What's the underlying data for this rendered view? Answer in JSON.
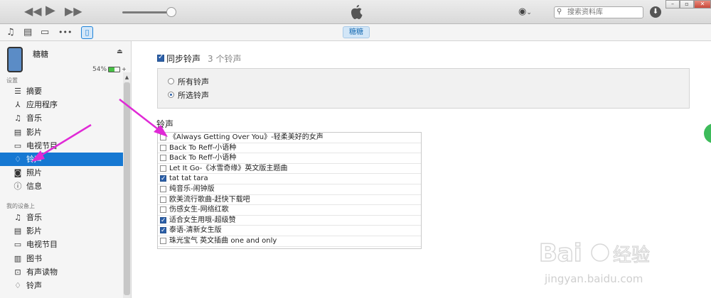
{
  "search": {
    "placeholder": "搜索资料库"
  },
  "device": {
    "name": "糖糖",
    "battery": "54%",
    "battery_level": 0.54
  },
  "device_tab": "糖糖",
  "sidebar": {
    "settings_heading": "设置",
    "settings_items": [
      {
        "label": "摘要",
        "icon": "summary-icon"
      },
      {
        "label": "应用程序",
        "icon": "apps-icon"
      },
      {
        "label": "音乐",
        "icon": "music-icon"
      },
      {
        "label": "影片",
        "icon": "film-icon"
      },
      {
        "label": "电视节目",
        "icon": "tv-icon"
      },
      {
        "label": "铃声",
        "icon": "bell-icon"
      },
      {
        "label": "照片",
        "icon": "camera-icon"
      },
      {
        "label": "信息",
        "icon": "info-icon"
      }
    ],
    "ondevice_heading": "我的设备上",
    "ondevice_items": [
      {
        "label": "音乐",
        "icon": "music-icon"
      },
      {
        "label": "影片",
        "icon": "film-icon"
      },
      {
        "label": "电视节目",
        "icon": "tv-icon"
      },
      {
        "label": "图书",
        "icon": "book-icon"
      },
      {
        "label": "有声读物",
        "icon": "audiobook-icon"
      },
      {
        "label": "铃声",
        "icon": "bell-icon"
      }
    ]
  },
  "main": {
    "sync_label": "同步铃声",
    "sync_count": "3 个铃声",
    "sync_checked": true,
    "options": [
      {
        "label": "所有铃声",
        "selected": false
      },
      {
        "label": "所选铃声",
        "selected": true
      }
    ],
    "ringtones_heading": "铃声",
    "ringtones": [
      {
        "name": "《Always Getting Over You》-轻柔美好的女声",
        "checked": false
      },
      {
        "name": "Back To Reff-小语种",
        "checked": false
      },
      {
        "name": "Back To Reff-小语种",
        "checked": false
      },
      {
        "name": "Let It Go-《冰雪奇缘》英文版主题曲",
        "checked": false
      },
      {
        "name": "tat tat tara",
        "checked": true
      },
      {
        "name": "纯音乐-闹钟版",
        "checked": false
      },
      {
        "name": "欧美流行歌曲-赶快下载吧",
        "checked": false
      },
      {
        "name": "伤感女生-网络红歌",
        "checked": false
      },
      {
        "name": "适合女生用哦-超级赞",
        "checked": true
      },
      {
        "name": "泰语-清新女生版",
        "checked": true
      },
      {
        "name": "珠光宝气 英文插曲 one and only",
        "checked": false
      }
    ]
  },
  "watermark": {
    "brand": "Bai",
    "brand2": "经验",
    "url": "jingyan.baidu.com"
  },
  "colors": {
    "selection": "#1678d2",
    "arrow": "#e02ad6",
    "accent": "#2c5fa8"
  }
}
